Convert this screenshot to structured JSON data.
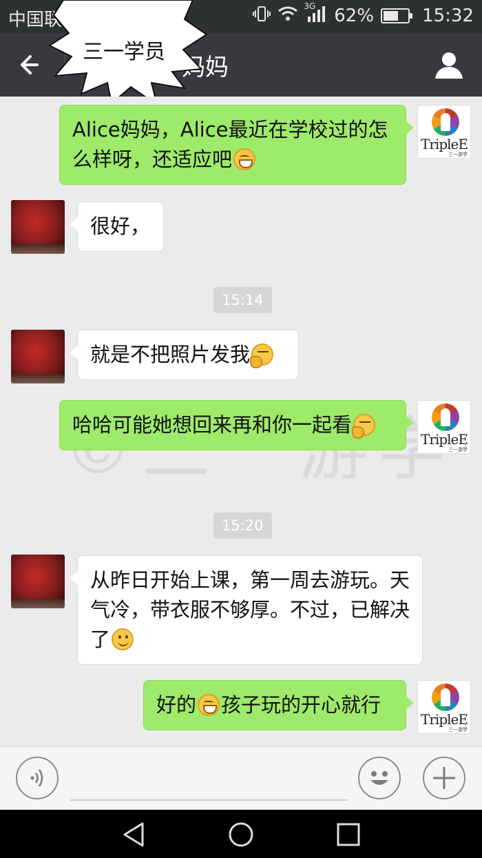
{
  "status_bar": {
    "carrier": "中国联通",
    "network": "3G",
    "battery": "62%",
    "battery_level": 0.62,
    "time": "15:32"
  },
  "title_bar": {
    "title": "妈妈",
    "sticker_text": "三一学员"
  },
  "watermark": "©三一游学",
  "avatars": {
    "brand_logo_text": "TripleE",
    "brand_logo_sub": "三一游学"
  },
  "messages": [
    {
      "side": "out",
      "text": "Alice妈妈，Alice最近在学校过的怎么样呀，还适应吧",
      "emoji": "grin-emoji"
    },
    {
      "side": "in",
      "text": "很好，",
      "emoji": ""
    },
    {
      "side": "time",
      "text": "15:14"
    },
    {
      "side": "in",
      "text": "就是不把照片发我",
      "emoji": "thinking-emoji"
    },
    {
      "side": "out",
      "text": "哈哈可能她想回来再和你一起看",
      "emoji": "thinking-emoji"
    },
    {
      "side": "time",
      "text": "15:20"
    },
    {
      "side": "in",
      "text": "从昨日开始上课，第一周去游玩。天气冷，带衣服不够厚。不过，已解决了",
      "emoji": "smile-emoji"
    },
    {
      "side": "out",
      "text_before": "好的",
      "text_after": "孩子玩的开心就行",
      "emoji": "grin-emoji"
    }
  ],
  "input_bar": {
    "voice_icon": "voice-icon",
    "emoji_icon": "emoji-icon",
    "plus_icon": "plus-icon"
  },
  "nav_bar": {
    "icons": [
      "back-triangle-icon",
      "home-circle-icon",
      "recent-square-icon"
    ]
  }
}
